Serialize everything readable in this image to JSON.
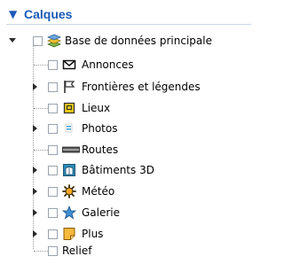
{
  "panel": {
    "title": "Calques",
    "collapse_glyph": "▼"
  },
  "root": {
    "label": "Base de données principale",
    "icon": "stacked-layers-icon",
    "expanded": true,
    "checked": false
  },
  "layers": [
    {
      "label": "Annonces",
      "icon": "envelope-icon",
      "expandable": false,
      "checked": false
    },
    {
      "label": "Frontières et légendes",
      "icon": "flag-icon",
      "expandable": true,
      "checked": false
    },
    {
      "label": "Lieux",
      "icon": "place-marker-icon",
      "expandable": false,
      "checked": false
    },
    {
      "label": "Photos",
      "icon": "photo-icon",
      "expandable": true,
      "checked": false
    },
    {
      "label": "Routes",
      "icon": "road-icon",
      "expandable": false,
      "checked": false
    },
    {
      "label": "Bâtiments 3D",
      "icon": "building-3d-icon",
      "expandable": true,
      "checked": false
    },
    {
      "label": "Météo",
      "icon": "sun-icon",
      "expandable": true,
      "checked": false
    },
    {
      "label": "Galerie",
      "icon": "star-icon",
      "expandable": true,
      "checked": false
    },
    {
      "label": "Plus",
      "icon": "note-icon",
      "expandable": true,
      "checked": false
    },
    {
      "label": "Relief",
      "icon": "",
      "expandable": false,
      "checked": false
    }
  ],
  "colors": {
    "header_text": "#1a59b7",
    "tree_line": "#9a9a9a",
    "checkbox_border": "#9aa3ad"
  }
}
